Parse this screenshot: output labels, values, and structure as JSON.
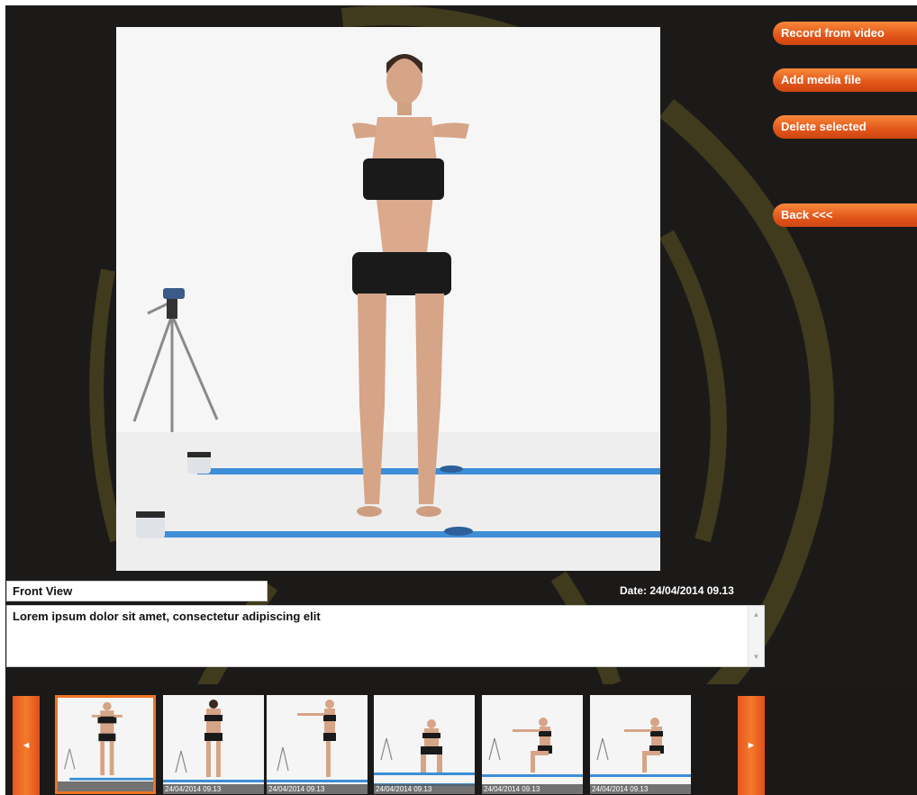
{
  "preview": {
    "image": "person-front-view-arms-raised"
  },
  "actions": {
    "record_label": "Record from video",
    "add_label": "Add media file",
    "delete_label": "Delete selected",
    "back_label": "Back <<<"
  },
  "details": {
    "title_value": "Front View",
    "date_text": "Date: 24/04/2014 09.13",
    "notes_text": "Lorem ipsum dolor sit amet, consectetur adipiscing elit"
  },
  "strip": {
    "prev_icon": "◄",
    "next_icon": "►",
    "thumbnails": [
      {
        "date": "",
        "selected": true,
        "image": "front-arms-raised"
      },
      {
        "date": "24/04/2014 09.13",
        "selected": false,
        "image": "back-view"
      },
      {
        "date": "24/04/2014 09.13",
        "selected": false,
        "image": "side-arms-raised"
      },
      {
        "date": "24/04/2014 09.13",
        "selected": false,
        "image": "front-squat"
      },
      {
        "date": "24/04/2014 09.13",
        "selected": false,
        "image": "side-squat"
      },
      {
        "date": "24/04/2014 09.13",
        "selected": false,
        "image": "side-squat-tripod"
      }
    ]
  },
  "theme": {
    "accent": "#ee7321",
    "background": "#1c1a19",
    "arc_color": "#6b6420"
  }
}
